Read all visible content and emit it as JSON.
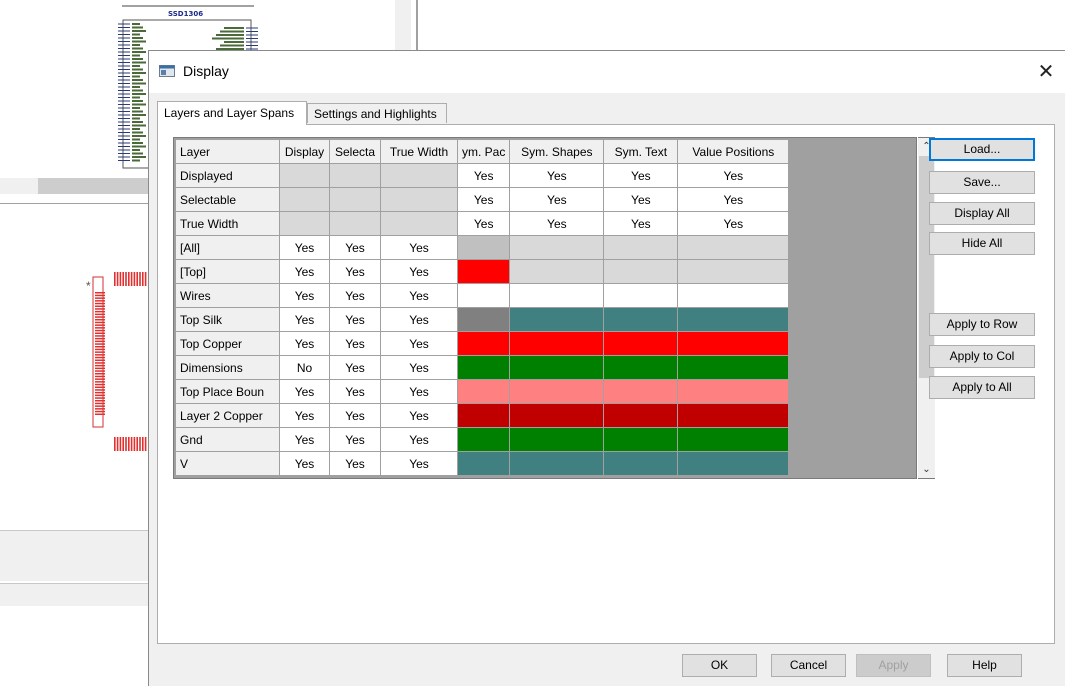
{
  "dialog": {
    "title": "Display",
    "tabs": [
      "Layers and Layer Spans",
      "Settings and Highlights"
    ],
    "grid": {
      "columns": [
        "Layer",
        "Display",
        "Selecta",
        "True Width",
        "ym. Pac",
        "Sym. Shapes",
        "Sym. Text",
        "Value Positions"
      ],
      "rows": [
        {
          "label": "Displayed",
          "vals": [
            "",
            "",
            "",
            "Yes",
            "Yes",
            "Yes",
            "Yes"
          ]
        },
        {
          "label": "Selectable",
          "vals": [
            "",
            "",
            "",
            "Yes",
            "Yes",
            "Yes",
            "Yes"
          ]
        },
        {
          "label": "True Width",
          "vals": [
            "",
            "",
            "",
            "Yes",
            "Yes",
            "Yes",
            "Yes"
          ]
        },
        {
          "label": "[All]",
          "vals": [
            "Yes",
            "Yes",
            "Yes"
          ],
          "color": "#d9d9d9",
          "swatch": "#c0c0c0"
        },
        {
          "label": "[Top]",
          "vals": [
            "Yes",
            "Yes",
            "Yes"
          ],
          "color": "#d9d9d9",
          "swatch": "#ff0000"
        },
        {
          "label": "Wires",
          "vals": [
            "Yes",
            "Yes",
            "Yes"
          ],
          "color": "#ffffff",
          "swatch": "#ffffff"
        },
        {
          "label": "Top Silk",
          "vals": [
            "Yes",
            "Yes",
            "Yes"
          ],
          "color": "#408080",
          "swatch": "#808080"
        },
        {
          "label": "Top Copper",
          "vals": [
            "Yes",
            "Yes",
            "Yes"
          ],
          "color": "#ff0000",
          "swatch": "#ff0000"
        },
        {
          "label": "Dimensions",
          "vals": [
            "No",
            "Yes",
            "Yes"
          ],
          "color": "#008000",
          "swatch": "#008000"
        },
        {
          "label": "Top Place Boun",
          "vals": [
            "Yes",
            "Yes",
            "Yes"
          ],
          "color": "#ff8080",
          "swatch": "#ff8080"
        },
        {
          "label": "Layer 2 Copper",
          "vals": [
            "Yes",
            "Yes",
            "Yes"
          ],
          "color": "#c00000",
          "swatch": "#c00000"
        },
        {
          "label": "Gnd",
          "vals": [
            "Yes",
            "Yes",
            "Yes"
          ],
          "color": "#008000",
          "swatch": "#008000"
        },
        {
          "label": "V",
          "vals": [
            "Yes",
            "Yes",
            "Yes"
          ],
          "color": "#408080",
          "swatch": "#408080"
        }
      ]
    },
    "side_buttons": {
      "load": "Load...",
      "save": "Save...",
      "display_all": "Display All",
      "hide_all": "Hide All",
      "apply_row": "Apply to Row",
      "apply_col": "Apply to Col",
      "apply_all": "Apply to All"
    },
    "footer": {
      "ok": "OK",
      "cancel": "Cancel",
      "apply": "Apply",
      "help": "Help"
    }
  },
  "schematic": {
    "title": "SSD1306"
  },
  "icons": {
    "close": "close-icon",
    "window": "window-icon",
    "up": "chevron-up-icon",
    "down": "chevron-down-icon"
  }
}
